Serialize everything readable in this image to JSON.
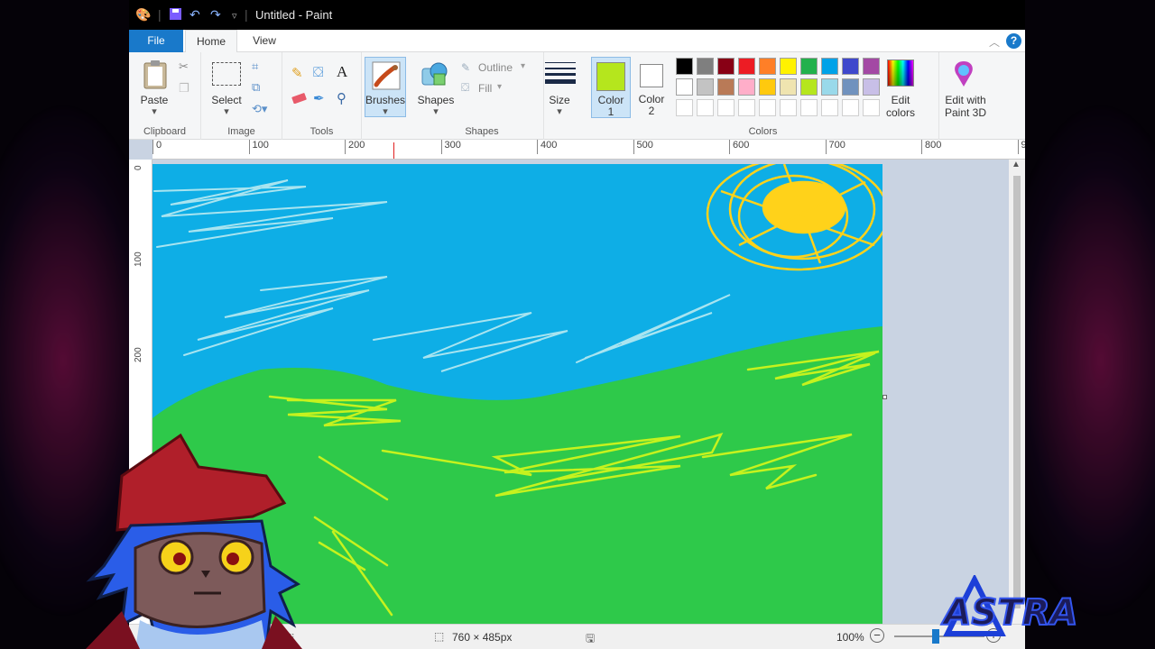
{
  "window": {
    "title": "Untitled - Paint"
  },
  "tabs": {
    "file": "File",
    "home": "Home",
    "view": "View"
  },
  "clipboard": {
    "paste": "Paste",
    "group": "Clipboard"
  },
  "image": {
    "select": "Select",
    "group": "Image"
  },
  "tools": {
    "group": "Tools",
    "text_tool": "A"
  },
  "brushes": {
    "label": "Brushes"
  },
  "shapes": {
    "label": "Shapes",
    "outline": "Outline",
    "fill": "Fill",
    "group": "Shapes"
  },
  "size": {
    "label": "Size"
  },
  "colors": {
    "color1_line1": "Color",
    "color1_line2": "1",
    "color2_line1": "Color",
    "color2_line2": "2",
    "color1": "#b5e61d",
    "color2": "#ffffff",
    "palette_row1": [
      "#000000",
      "#7f7f7f",
      "#880015",
      "#ed1c24",
      "#ff7f27",
      "#fff200",
      "#22b14c",
      "#00a2e8",
      "#3f48cc",
      "#a349a4"
    ],
    "palette_row2": [
      "#ffffff",
      "#c3c3c3",
      "#b97a57",
      "#ffaec9",
      "#ffc90e",
      "#efe4b0",
      "#b5e61d",
      "#99d9ea",
      "#7092be",
      "#c8bfe7"
    ],
    "edit_colors_line1": "Edit",
    "edit_colors_line2": "colors",
    "paint3d_line1": "Edit with",
    "paint3d_line2": "Paint 3D",
    "group": "Colors"
  },
  "ruler": {
    "h": [
      "0",
      "100",
      "200",
      "300",
      "400",
      "500",
      "600",
      "700",
      "800",
      "9"
    ],
    "v": [
      "0",
      "100",
      "200"
    ]
  },
  "status": {
    "size": "760 × 485px",
    "zoom": "100%"
  },
  "painting_colors": {
    "sky": "#0eaee6",
    "grass": "#2ec94a",
    "cloud": "#a8e4f0",
    "sun": "#ffd21a",
    "brush": "#c6f21e"
  },
  "logo": {
    "text": "ASTRA"
  }
}
